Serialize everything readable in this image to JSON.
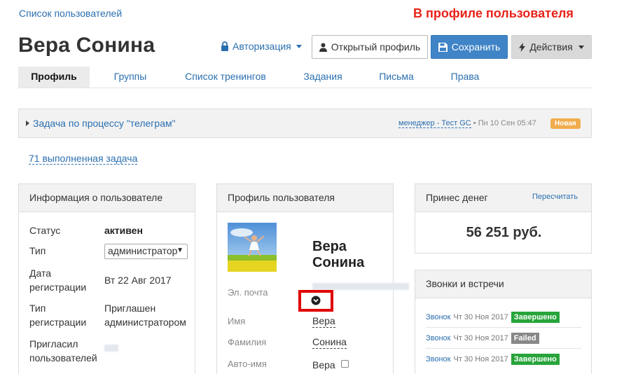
{
  "breadcrumb": "Список пользователей",
  "annotation": "В профиле пользователя",
  "user_name": "Вера Сонина",
  "header": {
    "auth_label": "Авторизация",
    "open_profile_label": "Открытый профиль",
    "save_label": "Сохранить",
    "actions_label": "Действия"
  },
  "tabs": [
    "Профиль",
    "Группы",
    "Список тренингов",
    "Задания",
    "Письма",
    "Права"
  ],
  "task": {
    "title": "Задача по процессу \"телеграм\"",
    "manager": "менеджер - Тест GC",
    "date": "Пн 10 Сен 05:47",
    "badge": "Новая"
  },
  "completed_tasks": "71 выполненная задача",
  "user_info": {
    "title": "Информация о пользователе",
    "status_label": "Статус",
    "status_value": "активен",
    "type_label": "Тип",
    "type_value": "администратор",
    "reg_date_label": "Дата регистрации",
    "reg_date_value": "Вт 22 Авг 2017",
    "reg_type_label": "Тип регистрации",
    "reg_type_value": "Приглашен администратором",
    "invited_by_label": "Пригласил пользователей"
  },
  "profile": {
    "title": "Профиль пользователя",
    "name_display": "Вера Сонина",
    "email_label": "Эл. почта",
    "first_name_label": "Имя",
    "first_name_value": "Вера",
    "last_name_label": "Фамилия",
    "last_name_value": "Сонина",
    "auto_name_label": "Авто-имя",
    "auto_name_value": "Вера"
  },
  "money": {
    "title": "Принес денег",
    "recalc_label": "Пересчитать",
    "amount": "56 251 руб."
  },
  "calls": {
    "title": "Звонки и встречи",
    "items": [
      {
        "type": "Звонок",
        "date": "Чт 30 Ноя 2017",
        "status": "Завершено",
        "kind": "done"
      },
      {
        "type": "Звонок",
        "date": "Чт 30 Ноя 2017",
        "status": "Failed",
        "kind": "fail"
      },
      {
        "type": "Звонок",
        "date": "Чт 30 Ноя 2017",
        "status": "Завершено",
        "kind": "done"
      }
    ]
  },
  "colors": {
    "link": "#2a6fb0",
    "save_button": "#3f84c6",
    "annotation": "#e8231a",
    "status_done": "#27a43a",
    "status_failed": "#888888",
    "badge_new": "#f0ad4e",
    "highlight_box": "#e00000"
  }
}
